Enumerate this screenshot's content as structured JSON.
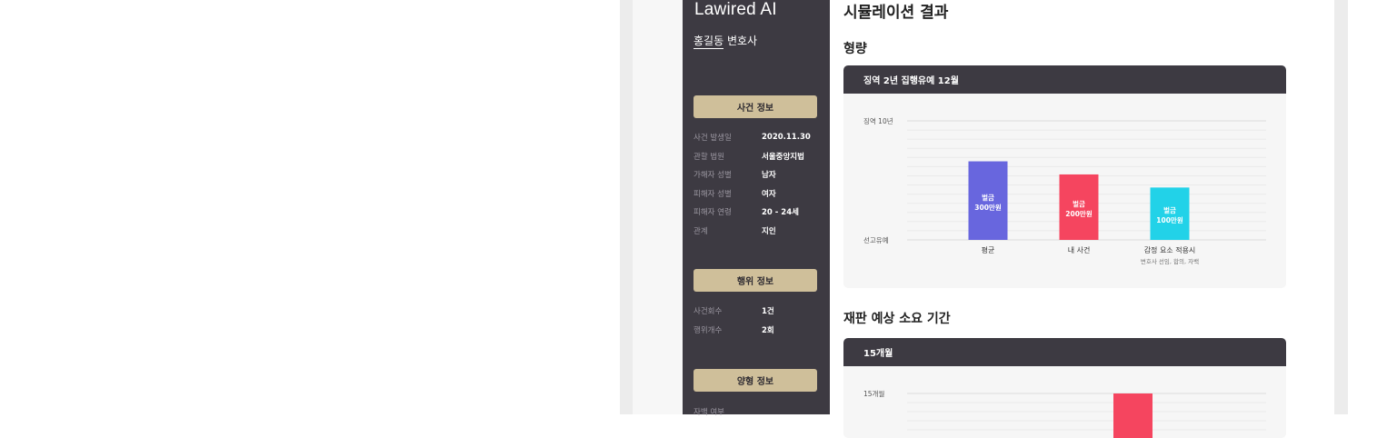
{
  "app": {
    "brand": "Lawired AI",
    "user_name": "홍길동",
    "user_title": " 변호사"
  },
  "sidebar": {
    "case_section": "사건 정보",
    "case_rows": [
      {
        "k": "사건 발생일",
        "v": "2020.11.30"
      },
      {
        "k": "관할 법원",
        "v": "서울중앙지법"
      },
      {
        "k": "가해자 성별",
        "v": "남자"
      },
      {
        "k": "피해자 성별",
        "v": "여자"
      },
      {
        "k": "피해자 연령",
        "v": "20 - 24세"
      },
      {
        "k": "관계",
        "v": "지인"
      }
    ],
    "act_section": "행위 정보",
    "act_rows": [
      {
        "k": "사건회수",
        "v": "1건"
      },
      {
        "k": "행위개수",
        "v": "2회"
      }
    ],
    "sentence_section": "양형 정보",
    "sentence_rows": [
      {
        "k": "자백 여부",
        "v": ""
      }
    ]
  },
  "main": {
    "title": "시뮬레이션 결과",
    "sentence_heading": "형량",
    "sentence_card_title": "징역 2년 집행유예 12월",
    "duration_heading": "재판 예상 소요 기간",
    "duration_card_title": "15개월"
  },
  "chart_data": [
    {
      "type": "bar",
      "title": "징역 2년 집행유예 12월",
      "y_tick_labels": [
        "징역 10년",
        "선고유예"
      ],
      "categories": [
        "평균",
        "내 사건",
        "감정 요소 적용시"
      ],
      "category_sublabels": [
        "",
        "",
        "변호사 선임, 합의, 자백"
      ],
      "bar_labels": [
        [
          "벌금",
          "300만원"
        ],
        [
          "벌금",
          "200만원"
        ],
        [
          "벌금",
          "100만원"
        ]
      ],
      "values": [
        0.66,
        0.55,
        0.44
      ],
      "colors": [
        "#6866de",
        "#f5455f",
        "#22d2e8"
      ],
      "grid": true
    },
    {
      "type": "bar",
      "title": "15개월",
      "y_tick_labels": [
        "15개월"
      ],
      "categories": [],
      "values": [],
      "highlight_color": "#f5455f",
      "grid": true
    }
  ]
}
